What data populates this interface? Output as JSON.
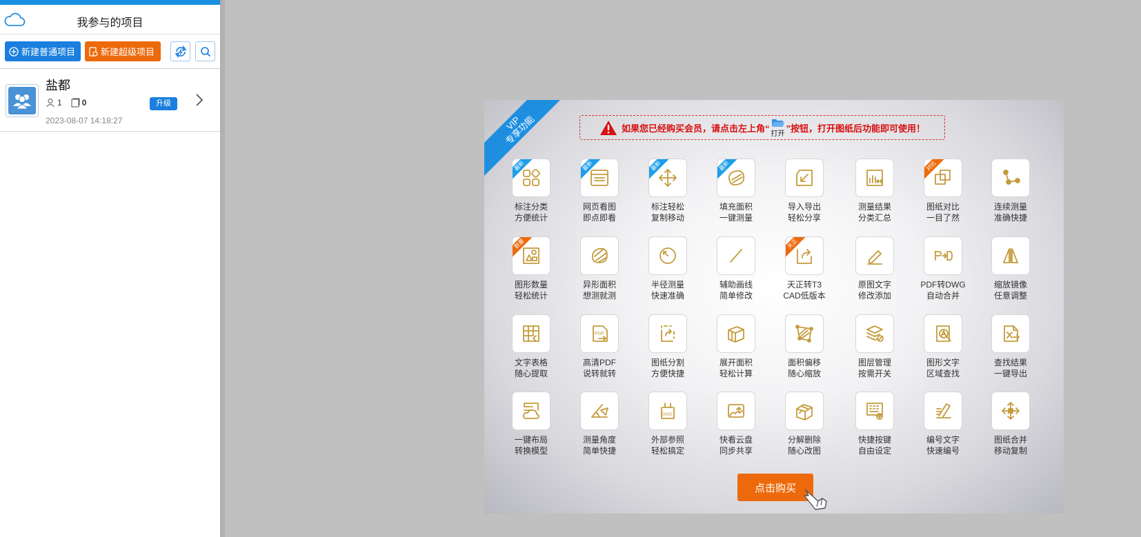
{
  "sidebar": {
    "title": "我参与的项目",
    "new_normal_label": "新建普通项目",
    "new_super_label": "新建超级项目",
    "project": {
      "name": "盐都",
      "members": "1",
      "files": "0",
      "date": "2023-08-07 14:18:27",
      "upgrade_label": "升级"
    }
  },
  "vip": {
    "ribbon_line1": "VIP",
    "ribbon_line2": "专享功能",
    "notice_before": "如果您已经购买会员，请点击左上角“",
    "notice_open": "打开",
    "notice_after": "”按钮，打开图纸后功能即可使用！",
    "buy_label": "点击购买",
    "tag_new": "最新",
    "tag_compare": "对比",
    "tag_count": "数量",
    "tag_tz": "天正",
    "features": [
      {
        "l1": "标注分类",
        "l2": "方便统计"
      },
      {
        "l1": "网页看图",
        "l2": "即点即看"
      },
      {
        "l1": "标注轻松",
        "l2": "复制移动"
      },
      {
        "l1": "填充面积",
        "l2": "一键测量"
      },
      {
        "l1": "导入导出",
        "l2": "轻松分享"
      },
      {
        "l1": "测量结果",
        "l2": "分类汇总"
      },
      {
        "l1": "图纸对比",
        "l2": "一目了然"
      },
      {
        "l1": "连续测量",
        "l2": "准确快捷"
      },
      {
        "l1": "图形数量",
        "l2": "轻松统计"
      },
      {
        "l1": "异形面积",
        "l2": "想测就测"
      },
      {
        "l1": "半径测量",
        "l2": "快速准确"
      },
      {
        "l1": "辅助画线",
        "l2": "简单修改"
      },
      {
        "l1": "天正转T3",
        "l2": "CAD低版本"
      },
      {
        "l1": "原图文字",
        "l2": "修改添加"
      },
      {
        "l1": "PDF转DWG",
        "l2": "自动合并"
      },
      {
        "l1": "缩放镜像",
        "l2": "任意调整"
      },
      {
        "l1": "文字表格",
        "l2": "随心提取"
      },
      {
        "l1": "高清PDF",
        "l2": "说转就转"
      },
      {
        "l1": "图纸分割",
        "l2": "方便快捷"
      },
      {
        "l1": "展开面积",
        "l2": "轻松计算"
      },
      {
        "l1": "面积偏移",
        "l2": "随心缩放"
      },
      {
        "l1": "图层管理",
        "l2": "按需开关"
      },
      {
        "l1": "图形文字",
        "l2": "区域查找"
      },
      {
        "l1": "查找结果",
        "l2": "一键导出"
      },
      {
        "l1": "一键布局",
        "l2": "转换模型"
      },
      {
        "l1": "测量角度",
        "l2": "简单快捷"
      },
      {
        "l1": "外部参照",
        "l2": "轻松搞定"
      },
      {
        "l1": "快看云盘",
        "l2": "同步共享"
      },
      {
        "l1": "分解删除",
        "l2": "随心改图"
      },
      {
        "l1": "快捷按键",
        "l2": "自由设定"
      },
      {
        "l1": "编号文字",
        "l2": "快速编号"
      },
      {
        "l1": "图纸合并",
        "l2": "移动复制"
      }
    ]
  }
}
